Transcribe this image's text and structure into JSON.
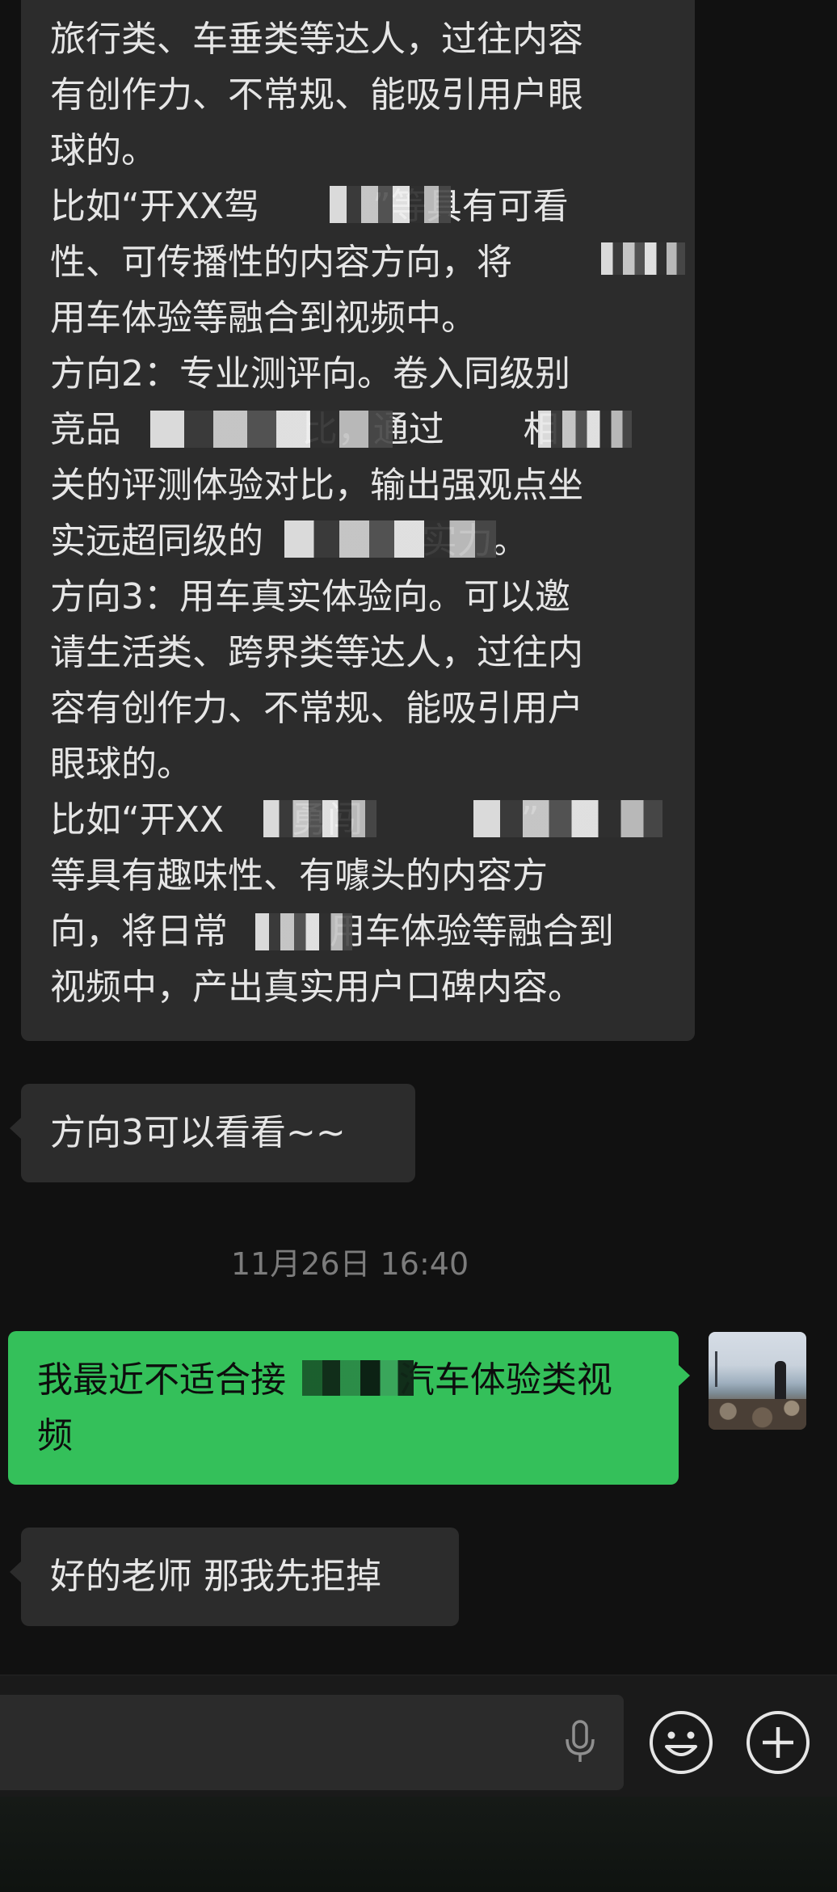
{
  "conversation": {
    "messages": [
      {
        "id": "msg-1",
        "sender": "contact",
        "lines": [
          "旅行类、车垂类等达人，过往内容",
          "有创作力、不常规、能吸引用户眼",
          "球的。",
          "比如“开XX驾          ”等具有可看",
          "性、可传播性的内容方向，将",
          "用车体验等融合到视频中。",
          "方向2：专业测评向。卷入同级别",
          "竞品                比，通过       相",
          "关的评测体验对比，输出强观点坐",
          "实远超同级的              实力。",
          "方向3：用车真实体验向。可以邀",
          "请生活类、跨界类等达人，过往内",
          "容有创作力、不常规、能吸引用户",
          "眼球的。",
          "比如“开XX      勇闯              ”",
          "等具有趣味性、有噱头的内容方",
          "向，将日常         用车体验等融合到",
          "视频中，产出真实用户口碑内容。"
        ]
      },
      {
        "id": "msg-2",
        "sender": "contact",
        "lines": [
          "方向3可以看看~~"
        ]
      },
      {
        "id": "msg-3",
        "sender": "me",
        "lines": [
          "我最近不适合接          汽车体验类视",
          "频"
        ]
      },
      {
        "id": "msg-4",
        "sender": "contact",
        "lines": [
          "好的老师 那我先拒掉"
        ]
      }
    ],
    "timestamp": "11月26日 16:40"
  },
  "composer": {
    "input_value": "",
    "voice_icon": "microphone-icon",
    "emoji_icon": "smiley-icon",
    "more_icon": "plus-circle-icon"
  },
  "colors": {
    "background": "#111111",
    "bubble_received": "#2c2c2c",
    "bubble_sent": "#34c05a",
    "timestamp": "#7c7c7c"
  }
}
